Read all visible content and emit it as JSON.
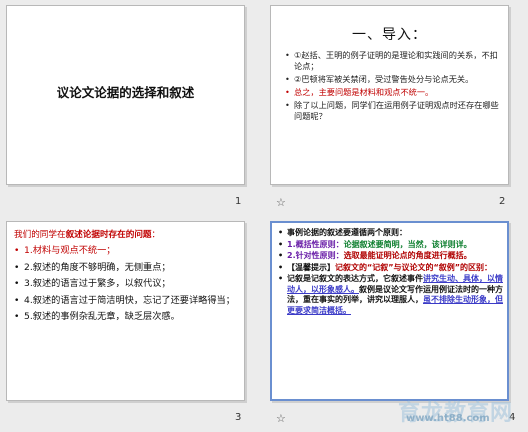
{
  "slides": [
    {
      "number": "1",
      "title": "议论文论据的选择和叙述"
    },
    {
      "number": "2",
      "title": "一、导入：",
      "bullets": [
        "①赵括、王明的例子证明的是理论和实践间的关系，不扣论点；",
        "②巴顿将军被关禁闭，受过警告处分与论点无关。",
        "总之，主要问题是材料和观点不统一。",
        "除了以上问题，同学们在运用例子证明观点时还存在哪些问题呢？"
      ]
    },
    {
      "number": "3",
      "heading_prefix": "我们的同学在",
      "heading_bold": "叙述论据时存在的问题",
      "heading_suffix": "：",
      "bullets": [
        "1.材料与观点不统一；",
        "2.叙述的角度不够明确，无侧重点；",
        "3.叙述的语言过于繁多，以叙代议；",
        "4.叙述的语言过于简洁明快，忘记了还要详略得当；",
        "5.叙述的事例杂乱无章，缺乏层次感。"
      ]
    },
    {
      "number": "4",
      "line1": "事例论据的叙述要遵循两个原则：",
      "line2a": "1.概括性原则：",
      "line2b": "论据叙述要简明，当然，该详则详。",
      "line3a": "2.针对性原则：",
      "line3b": "选取最能证明论点的角度进行概括。",
      "line4a": "【温馨提示】",
      "line4b": "记叙文的“记叙”与议论文的“叙例”的区别：",
      "line5a": "记叙是记叙文的表达方式，它叙述事件",
      "line5b": "讲究生动、具体，以情动人，以形象感人。",
      "line5c": "叙例是议论文写作运用例证法时的一种方法，重在事实的列举，讲究以理服人，",
      "line5d": "虽不排除生动形象，但更要求简洁概括。"
    }
  ],
  "watermark": {
    "text": "育龙教育网",
    "url": "www.ht88.com"
  },
  "star_icon": "☆"
}
